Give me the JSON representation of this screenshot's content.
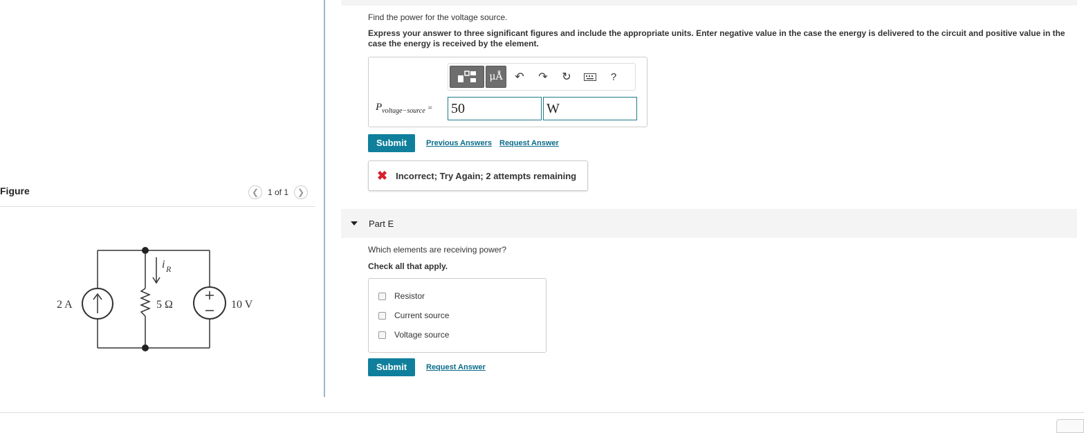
{
  "figure": {
    "title": "Figure",
    "pager": "1 of 1",
    "prev_icon": "chevron-left-icon",
    "next_icon": "chevron-right-icon",
    "circuit": {
      "current_source_label": "2 A",
      "resistor_label": "5 Ω",
      "voltage_source_label": "10 V",
      "current_label": "i",
      "current_sub": "R"
    }
  },
  "part_d": {
    "question": "Find the power for the voltage source.",
    "instructions": "Express your answer to three significant figures and include the appropriate units. Enter negative value in the case the energy is delivered to the circuit and positive value in the case the energy is received by the element.",
    "toolbar": {
      "templates_icon": "templates-icon",
      "units_label": "μÅ",
      "undo_icon": "undo-icon",
      "redo_icon": "redo-icon",
      "reset_icon": "reset-icon",
      "keyboard_icon": "keyboard-icon",
      "help_label": "?"
    },
    "variable": "P",
    "variable_sub": "voltage−source",
    "equals": "=",
    "value": "50",
    "unit": "W",
    "submit_label": "Submit",
    "previous_answers_label": "Previous Answers",
    "request_answer_label": "Request Answer",
    "feedback": "Incorrect; Try Again; 2 attempts remaining",
    "feedback_color": "#d8202f"
  },
  "part_e": {
    "title": "Part E",
    "question": "Which elements are receiving power?",
    "check_note": "Check all that apply.",
    "options": [
      "Resistor",
      "Current source",
      "Voltage source"
    ],
    "submit_label": "Submit",
    "request_answer_label": "Request Answer"
  },
  "colors": {
    "accent": "#0f7f9c",
    "link": "#0a6b8a"
  }
}
